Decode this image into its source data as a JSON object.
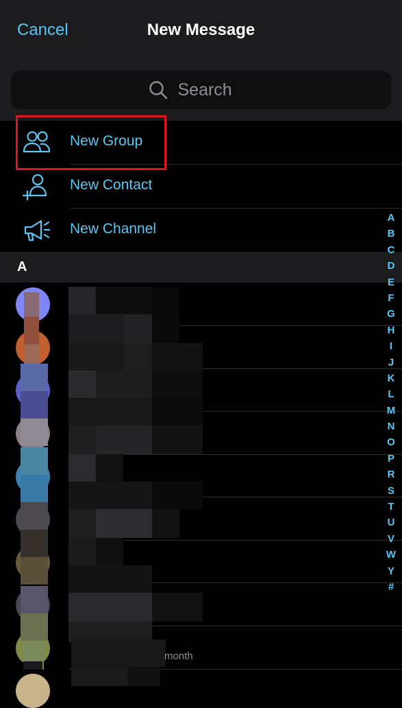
{
  "header": {
    "cancel_label": "Cancel",
    "title": "New Message",
    "search_placeholder": "Search"
  },
  "menu": [
    {
      "label": "New Group",
      "icon": "group-icon"
    },
    {
      "label": "New Contact",
      "icon": "add-contact-icon"
    },
    {
      "label": "New Channel",
      "icon": "megaphone-icon"
    }
  ],
  "section_header": "A",
  "contacts": {
    "partial_status": "month"
  },
  "alphabet": [
    "A",
    "B",
    "C",
    "D",
    "E",
    "F",
    "G",
    "H",
    "I",
    "J",
    "K",
    "L",
    "M",
    "N",
    "O",
    "P",
    "R",
    "S",
    "T",
    "U",
    "V",
    "W",
    "Y",
    "#"
  ],
  "colors": {
    "accent": "#5ac8f5",
    "header_bg": "#1c1c1e",
    "highlight": "#e0141d"
  }
}
